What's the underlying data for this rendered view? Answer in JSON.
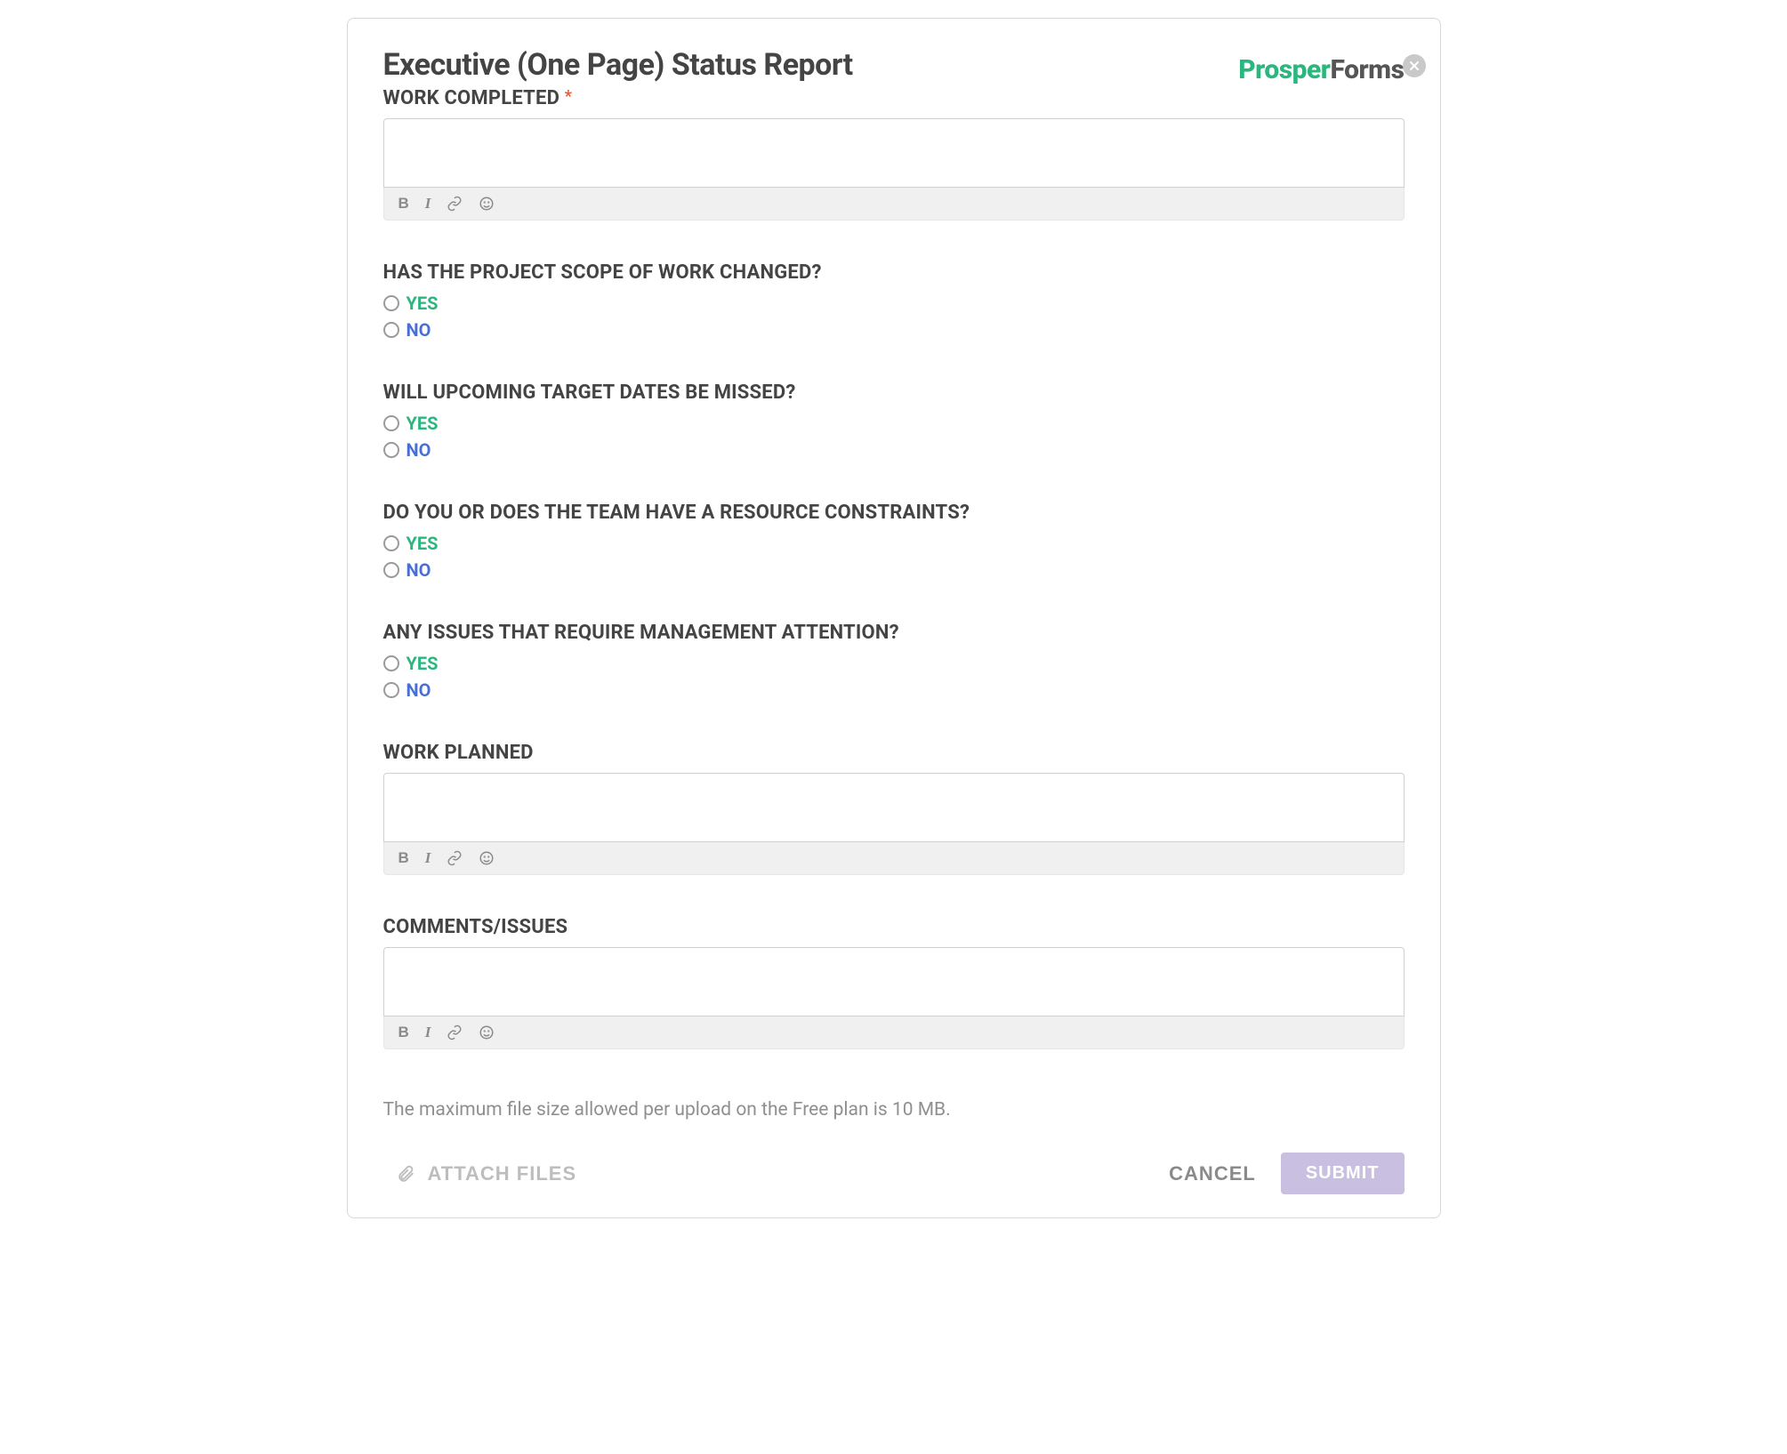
{
  "title": "Executive (One Page) Status Report",
  "logo": {
    "part1": "Prosper",
    "part2": "Forms"
  },
  "required_marker": "*",
  "fields": {
    "work_completed": {
      "label": "WORK COMPLETED",
      "required": true
    },
    "scope_changed": {
      "label": "HAS THE PROJECT SCOPE OF WORK CHANGED?"
    },
    "dates_missed": {
      "label": "WILL UPCOMING TARGET DATES BE MISSED?"
    },
    "resource_constraints": {
      "label": "DO YOU OR DOES THE TEAM HAVE A RESOURCE CONSTRAINTS?"
    },
    "mgmt_attention": {
      "label": "ANY ISSUES THAT REQUIRE MANAGEMENT ATTENTION?"
    },
    "work_planned": {
      "label": "WORK PLANNED"
    },
    "comments": {
      "label": "COMMENTS/ISSUES"
    }
  },
  "radio_options": {
    "yes": "YES",
    "no": "NO"
  },
  "toolbar": {
    "bold": "B",
    "italic": "I"
  },
  "hint": "The maximum file size allowed per upload on the Free plan is 10 MB.",
  "footer": {
    "attach": "ATTACH FILES",
    "cancel": "CANCEL",
    "submit": "SUBMIT"
  }
}
